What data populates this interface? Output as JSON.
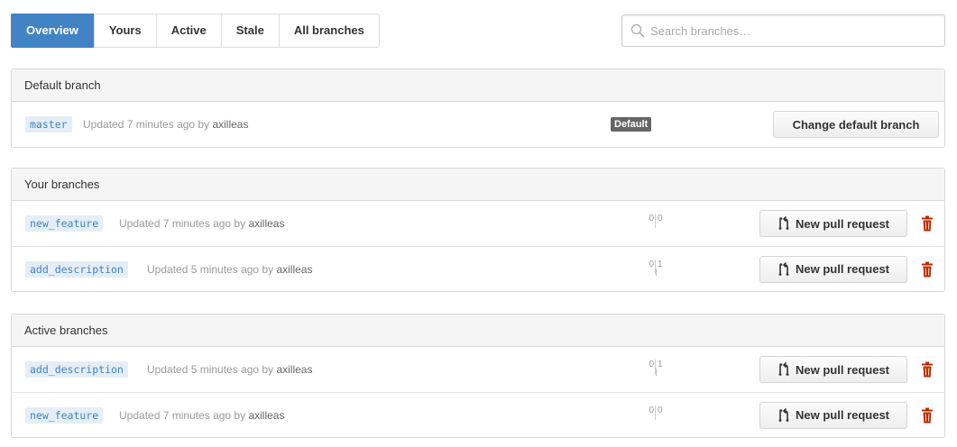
{
  "tabs": [
    {
      "label": "Overview",
      "active": true
    },
    {
      "label": "Yours",
      "active": false
    },
    {
      "label": "Active",
      "active": false
    },
    {
      "label": "Stale",
      "active": false
    },
    {
      "label": "All branches",
      "active": false
    }
  ],
  "search": {
    "placeholder": "Search branches…",
    "icon": "search-icon"
  },
  "default_section": {
    "title": "Default branch",
    "branch": {
      "name": "master",
      "updated": "Updated 7 minutes ago by",
      "author": "axilleas"
    },
    "badge": "Default",
    "button": "Change default branch"
  },
  "your_section": {
    "title": "Your branches",
    "rows": [
      {
        "name": "new_feature",
        "updated": "Updated 7 minutes ago by",
        "author": "axilleas",
        "behind": "0",
        "ahead": "0",
        "button": "New pull request"
      },
      {
        "name": "add_description",
        "updated": "Updated 5 minutes ago by",
        "author": "axilleas",
        "behind": "0",
        "ahead": "1",
        "button": "New pull request"
      }
    ]
  },
  "active_section": {
    "title": "Active branches",
    "rows": [
      {
        "name": "add_description",
        "updated": "Updated 5 minutes ago by",
        "author": "axilleas",
        "behind": "0",
        "ahead": "1",
        "button": "New pull request"
      },
      {
        "name": "new_feature",
        "updated": "Updated 7 minutes ago by",
        "author": "axilleas",
        "behind": "0",
        "ahead": "0",
        "button": "New pull request"
      }
    ]
  },
  "colors": {
    "accent": "#4183c4",
    "delete": "#bd2c00",
    "badge": "#666666"
  }
}
